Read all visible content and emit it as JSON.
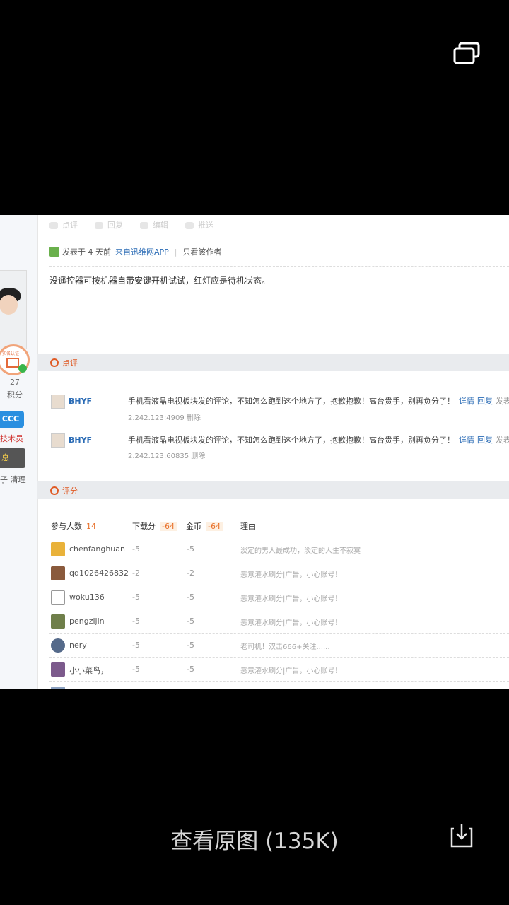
{
  "colors": {
    "background": "#000000",
    "link": "#2a6bb5",
    "section_title": "#e05a24",
    "accent_orange": "#e8702a"
  },
  "viewer": {
    "top_icon": "window-restore-icon",
    "view_original_label": "查看原图 (135K)",
    "download_icon": "download-icon"
  },
  "toolbar": {
    "items": [
      {
        "label": "点评",
        "icon": "comment-icon"
      },
      {
        "label": "回复",
        "icon": "reply-icon"
      },
      {
        "label": "编辑",
        "icon": "edit-icon"
      },
      {
        "label": "推送",
        "icon": "push-icon"
      }
    ]
  },
  "left_panel": {
    "verified_label": "实名认证",
    "points_value": "27",
    "points_label": "积分",
    "blue_badge": "CCC",
    "role_text": "技术员",
    "dark_button": "息",
    "tail_text": "子 清理"
  },
  "post": {
    "info_prefix": "发表于 4 天前",
    "source_link": "来自迅维网APP",
    "only_author": "只看该作者",
    "body": "没遥控器可按机器自带安键开机试试，红灯应是待机状态。"
  },
  "comments_section": {
    "title": "点评",
    "items": [
      {
        "name": "BHYF",
        "text": "手机看液晶电视板块发的评论，不知怎么跑到这个地方了，抱歉抱歉！高台贵手，别再负分了！",
        "detail": "详情",
        "reply": "回复",
        "tail": "发表",
        "ip": "2.242.123:4909",
        "delete": "删除"
      },
      {
        "name": "BHYF",
        "text": "手机看液晶电视板块发的评论，不知怎么跑到这个地方了，抱歉抱歉！高台贵手，别再负分了！",
        "detail": "详情",
        "reply": "回复",
        "tail": "发表",
        "ip": "2.242.123:60835",
        "delete": "删除"
      }
    ]
  },
  "rating_section": {
    "title": "评分",
    "headers": {
      "participants": "参与人数",
      "participants_count": "14",
      "download": "下载分",
      "download_total": "-64",
      "coins": "金币",
      "coins_total": "-64",
      "reason": "理由"
    },
    "rows": [
      {
        "user": "chenfanghuan",
        "download": "-5",
        "coins": "-5",
        "reason": "淡定的男人最成功，淡定的人生不寂寞"
      },
      {
        "user": "qq1026426832",
        "download": "-2",
        "coins": "-2",
        "reason": "恶意灌水刷分|广告，小心账号！"
      },
      {
        "user": "woku136",
        "download": "-5",
        "coins": "-5",
        "reason": "恶意灌水刷分|广告，小心账号！"
      },
      {
        "user": "pengzijin",
        "download": "-5",
        "coins": "-5",
        "reason": "恶意灌水刷分|广告，小心账号！"
      },
      {
        "user": "nery",
        "download": "-5",
        "coins": "-5",
        "reason": "老司机！双击666+关注......"
      },
      {
        "user": "小小菜鸟，",
        "download": "-5",
        "coins": "-5",
        "reason": "恶意灌水刷分|广告，小心账号！"
      }
    ]
  }
}
